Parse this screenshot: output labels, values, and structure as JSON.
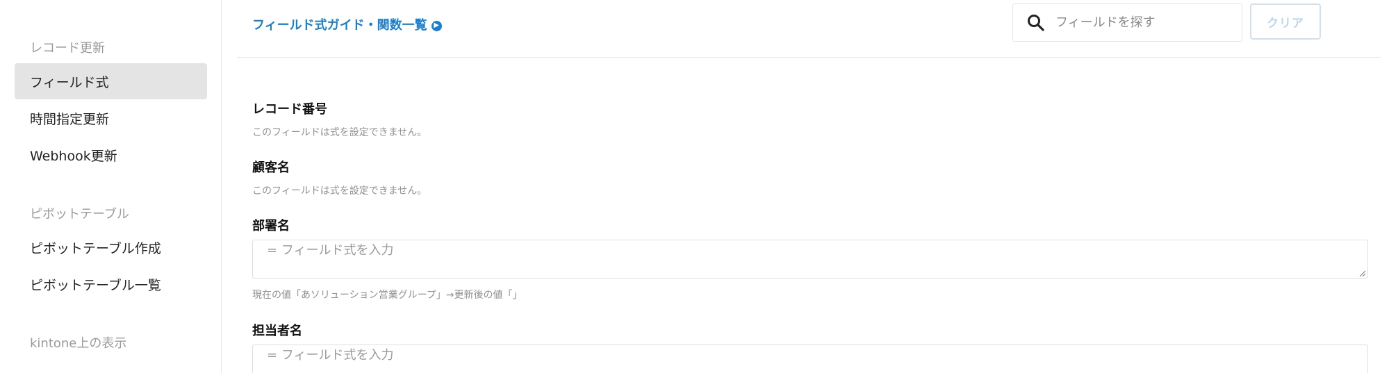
{
  "sidebar": {
    "sections": [
      {
        "heading": "レコード更新",
        "items": [
          {
            "label": "フィールド式",
            "active": true
          },
          {
            "label": "時間指定更新",
            "active": false
          },
          {
            "label": "Webhook更新",
            "active": false
          }
        ]
      },
      {
        "heading": "ピボットテーブル",
        "items": [
          {
            "label": "ピボットテーブル作成",
            "active": false
          },
          {
            "label": "ピボットテーブル一覧",
            "active": false
          }
        ]
      },
      {
        "heading": "kintone上の表示",
        "items": []
      }
    ]
  },
  "topbar": {
    "guide_link": "フィールド式ガイド・関数一覧",
    "guide_icon": "arrow-right-circle-icon",
    "search_icon": "search-icon",
    "search_placeholder": "フィールドを探す",
    "clear_label": "クリア"
  },
  "fields": [
    {
      "label": "レコード番号",
      "note": "このフィールドは式を設定できません。"
    },
    {
      "label": "顧客名",
      "note": "このフィールドは式を設定できません。"
    },
    {
      "label": "部署名",
      "placeholder": "= フィールド式を入力",
      "current_value": "現在の値「あソリューション営業グループ」→更新後の値「」"
    },
    {
      "label": "担当者名",
      "placeholder": "= フィールド式を入力"
    }
  ],
  "colors": {
    "accent": "#1a7fcc",
    "active_item_bg": "#e4e4e4",
    "muted_text": "#9a9a9a",
    "clear_button_border": "#cfe2f3"
  }
}
